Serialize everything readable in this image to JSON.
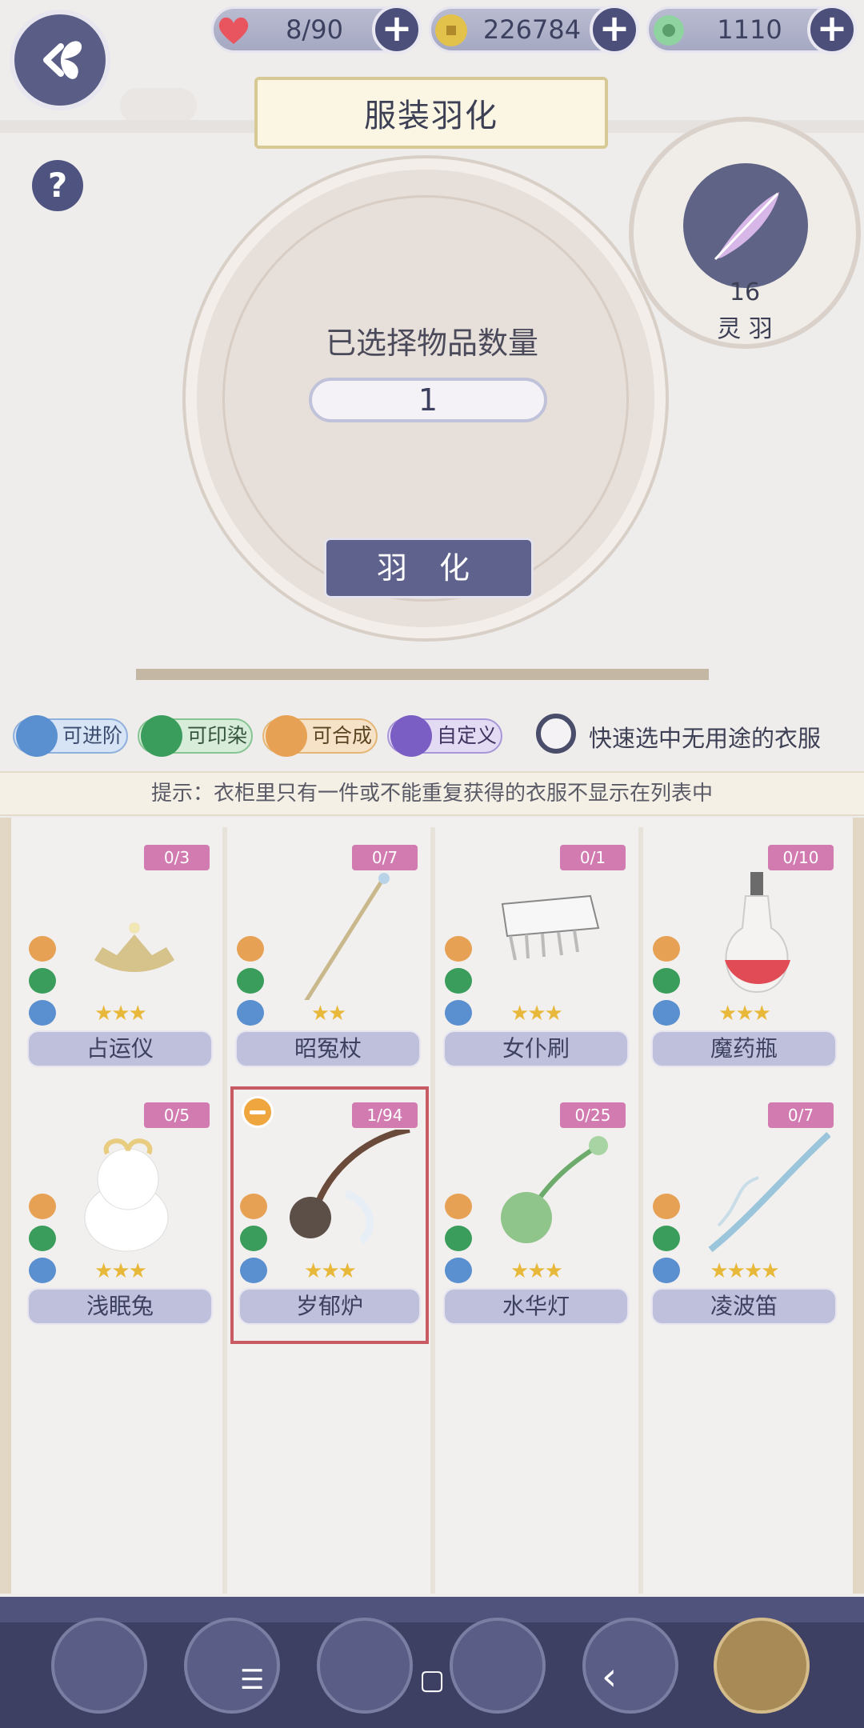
{
  "resources": {
    "stamina": "8/90",
    "coins": "226784",
    "gems": "1110"
  },
  "title": "服装羽化",
  "help_label": "?",
  "selected_label": "已选择物品数量",
  "selected_count": "1",
  "action_button": "羽 化",
  "feather": {
    "count": "16",
    "name": "灵 羽"
  },
  "filters": [
    {
      "label": "可进阶",
      "color": "#5a8fd0"
    },
    {
      "label": "可印染",
      "color": "#3a9d5c"
    },
    {
      "label": "可合成",
      "color": "#e7a154"
    },
    {
      "label": "自定义",
      "color": "#7a5ec4"
    }
  ],
  "quick_select_label": "快速选中无用途的衣服",
  "tip": "提示：衣柜里只有一件或不能重复获得的衣服不显示在列表中",
  "items": [
    {
      "name": "占运仪",
      "count": "0/3",
      "stars": "★★★",
      "selected": false
    },
    {
      "name": "昭冤杖",
      "count": "0/7",
      "stars": "★★",
      "selected": false
    },
    {
      "name": "女仆刷",
      "count": "0/1",
      "stars": "★★★",
      "selected": false
    },
    {
      "name": "魔药瓶",
      "count": "0/10",
      "stars": "★★★",
      "selected": false
    },
    {
      "name": "浅眠兔",
      "count": "0/5",
      "stars": "★★★",
      "selected": false
    },
    {
      "name": "岁郁炉",
      "count": "1/94",
      "stars": "★★★",
      "selected": true
    },
    {
      "name": "水华灯",
      "count": "0/25",
      "stars": "★★★",
      "selected": false
    },
    {
      "name": "凌波笛",
      "count": "0/7",
      "stars": "★★★★",
      "selected": false
    }
  ],
  "nav": [
    "hair",
    "dress",
    "shoes",
    "accessory",
    "jewelry",
    "lantern"
  ],
  "system_nav": {
    "menu": "☰",
    "home": "▢",
    "back": "‹"
  }
}
